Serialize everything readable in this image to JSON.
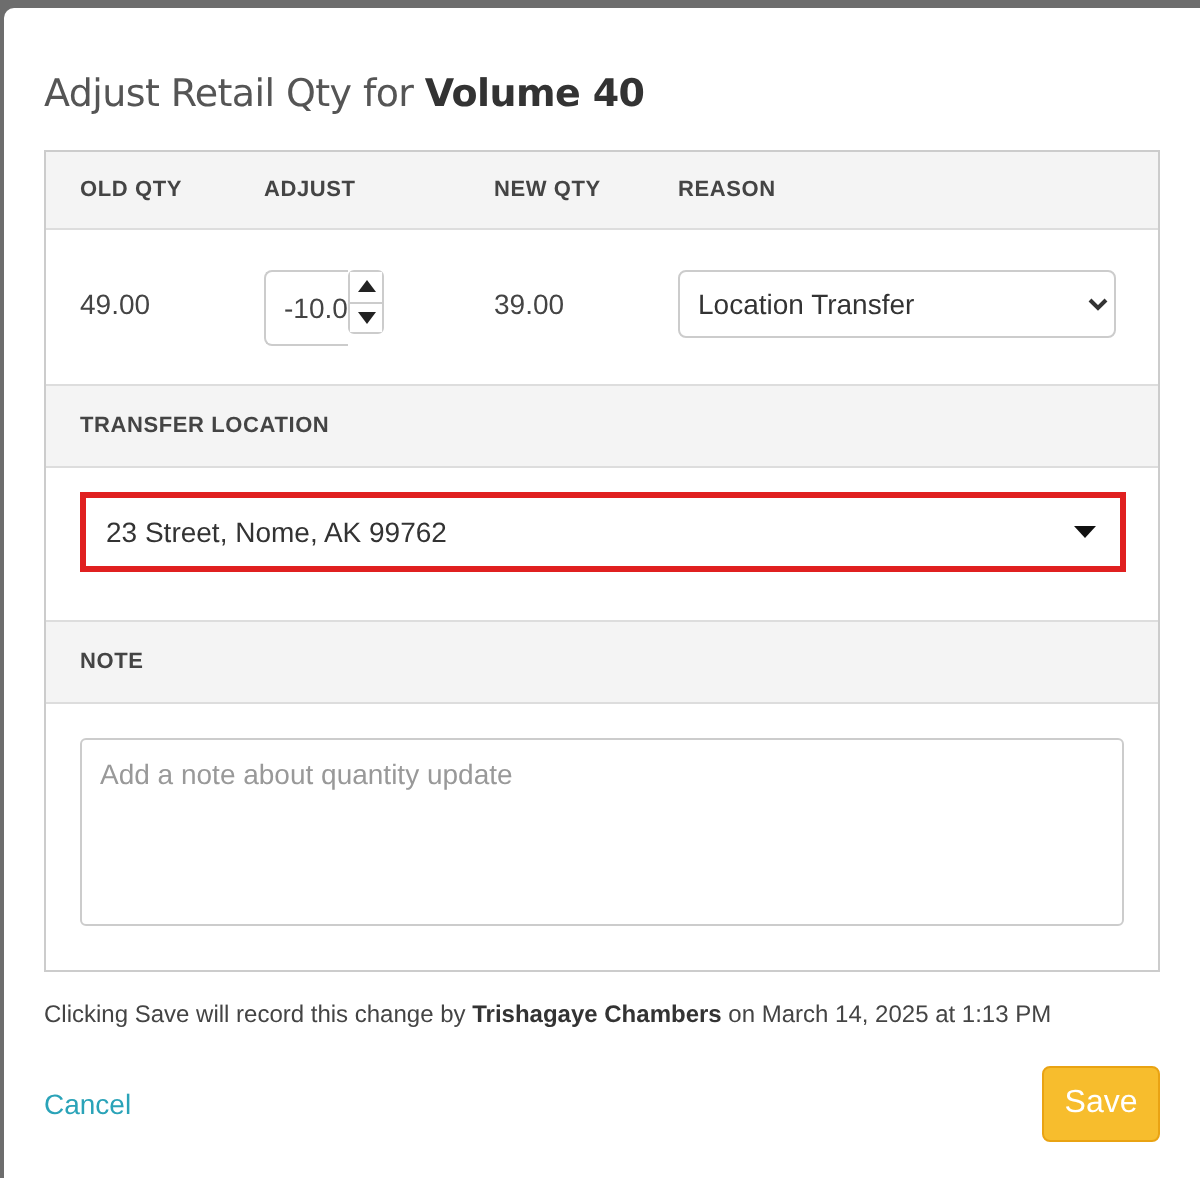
{
  "dialog": {
    "title": "Adjust Retail Qty for **Volume 40**"
  },
  "adjustment": {
    "columns": [
      "OLD QTY",
      "ADJUST",
      "NEW QTY",
      "REASON"
    ],
    "old_qty": "49.00",
    "adjust": {
      "value": "-10.0"
    },
    "new_qty": "39.00",
    "reason": {
      "value": "Location Transfer"
    }
  },
  "transfer_location": {
    "heading": "TRANSFER LOCATION",
    "value": "23 Street, Nome, AK 99762",
    "highlighted": true
  },
  "note": {
    "heading": "NOTE",
    "placeholder": "Add a note about quantity update"
  },
  "footer_note": "Clicking Save will record this change by **Trishagaye Chambers** on March 14, 2025 at 1:13 PM",
  "buttons": {
    "cancel": "Cancel",
    "save": "Save"
  }
}
